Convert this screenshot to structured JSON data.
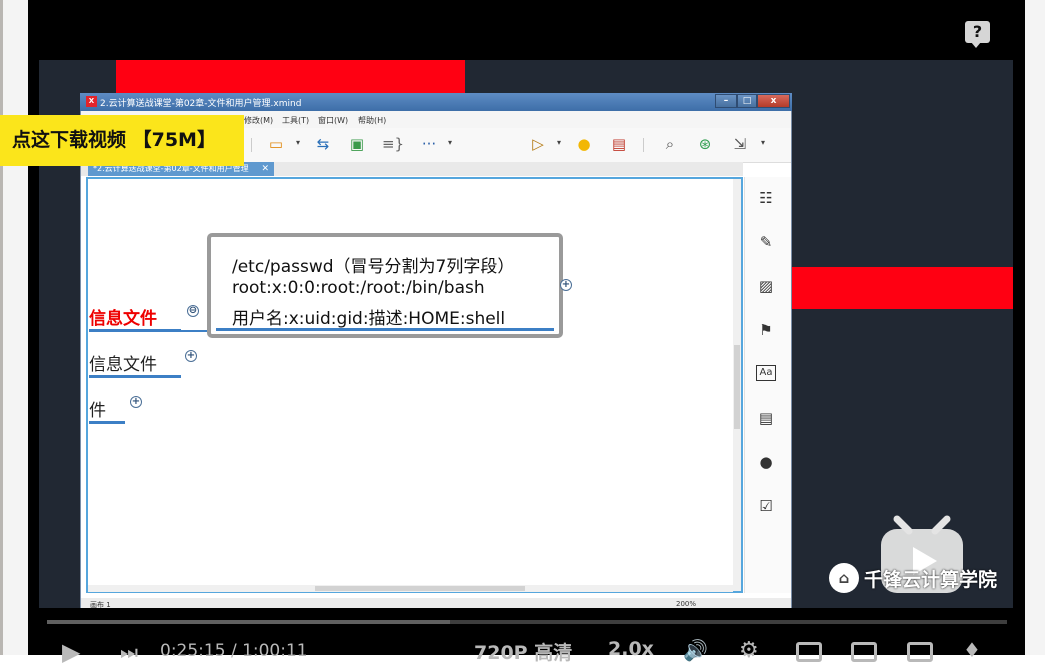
{
  "window": {
    "title": "2.云计算送战课堂-第02章-文件和用户管理.xmind",
    "logo": "X",
    "buttons": {
      "minimize": "–",
      "maximize": "□",
      "close": "x"
    }
  },
  "menu": {
    "items": [
      "修改(M)",
      "工具(T)",
      "窗口(W)",
      "帮助(H)"
    ]
  },
  "toolbar": {
    "icons": [
      {
        "name": "topic-tool-icon",
        "glyph": "▭",
        "color": "#e08a12"
      },
      {
        "name": "relationship-icon",
        "glyph": "⇆",
        "color": "#2a6fb8"
      },
      {
        "name": "boundary-icon",
        "glyph": "▣",
        "color": "#3a9a4a"
      },
      {
        "name": "summary-icon",
        "glyph": "≡}",
        "color": "#666666"
      },
      {
        "name": "more-icon",
        "glyph": "···",
        "color": "#2a5fa8"
      },
      {
        "name": "presentation-icon",
        "glyph": "▷",
        "color": "#b47a12"
      },
      {
        "name": "brainstorm-icon",
        "glyph": "●",
        "color": "#f2b705"
      },
      {
        "name": "gantt-icon",
        "glyph": "▤",
        "color": "#c0392b"
      },
      {
        "name": "search-icon",
        "glyph": "⌕",
        "color": "#555555"
      },
      {
        "name": "share-icon",
        "glyph": "⊛",
        "color": "#2e9d4d"
      },
      {
        "name": "export-icon",
        "glyph": "⇲",
        "color": "#555555"
      }
    ]
  },
  "tab": {
    "label": "*2.云计算送战课堂-第02章-文件和用户管理",
    "close": "✕"
  },
  "topics": [
    {
      "label": "信息文件",
      "toggle": "⊖"
    },
    {
      "label": "信息文件",
      "toggle": "+"
    },
    {
      "label": "件",
      "toggle": "+"
    }
  ],
  "callout": {
    "lines": [
      "/etc/passwd（冒号分割为7列字段）",
      " root:x:0:0:root:/root:/bin/bash",
      "用户名:x:uid:gid:描述:HOME:shell"
    ],
    "toggle": "+"
  },
  "sidebar": {
    "icons": [
      {
        "name": "outline-icon",
        "glyph": "☷"
      },
      {
        "name": "format-brush-icon",
        "glyph": "✎"
      },
      {
        "name": "image-icon",
        "glyph": "▨"
      },
      {
        "name": "marker-flag-icon",
        "glyph": "⚑"
      },
      {
        "name": "font-icon",
        "glyph": "Aa"
      },
      {
        "name": "notes-icon",
        "glyph": "▤"
      },
      {
        "name": "comment-icon",
        "glyph": "●"
      },
      {
        "name": "task-icon",
        "glyph": "☑"
      }
    ]
  },
  "statusbar": {
    "sheet": "画布 1",
    "zoom": "200%"
  },
  "banner": {
    "text": "点这下载视频 【75M】"
  },
  "watermark": {
    "text": "千锋云计算学院",
    "badge": "⌂"
  },
  "player": {
    "help": "?",
    "time": "0:25:15 / 1:00:11",
    "progress": 0.42,
    "quality": "720P 高清",
    "speed": "2.0x",
    "play": "▶",
    "next": "⏭",
    "volume": "🔊",
    "settings": "⚙",
    "more": "♦"
  }
}
